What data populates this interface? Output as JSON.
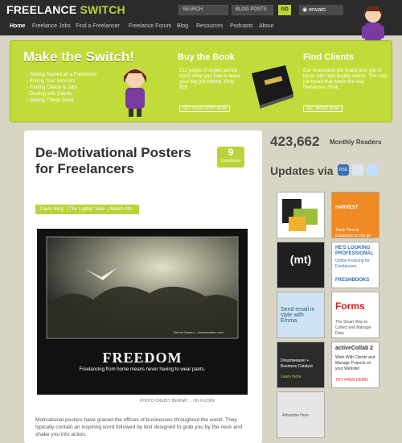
{
  "header": {
    "logo_part1": "FREELANCE",
    "logo_part2": "SWITCH",
    "search_placeholder": "SEARCH",
    "blog_select": "BLOG POSTS",
    "go": "GO",
    "envato": "envato"
  },
  "nav": [
    "Home",
    "Freelance Jobs",
    "Find a Freelancer",
    "Freelance Forum",
    "Blog",
    "Resources",
    "Podcasts",
    "About"
  ],
  "hero": {
    "title": "Make the Switch!",
    "links": [
      "Getting Started as a Freelancer",
      "Pricing Your Services",
      "Finding Clients & Jobs",
      "Dealing with Clients",
      "Getting Things Done"
    ],
    "book_title": "Buy the Book",
    "book_text": "212 pages of expert advice that'll show you how to leave your day job behind. Only $29.",
    "book_btn": "GET YOUR COPY NOW",
    "clients_title": "Find Clients",
    "clients_text": "Our moderated job board puts you in touch with high-quality clients. The only job board that works the way freelancers think.",
    "clients_btn": "GET WORK NOW"
  },
  "article": {
    "title": "De-Motivational Posters for Freelancers",
    "comments_count": "9",
    "comments_label": "Comments",
    "meta": [
      "Travis King",
      "The Lighter Side",
      "March 4th"
    ],
    "poster_title": "FREEDOM",
    "poster_sub": "Freelancing from home means never having to wear pants.",
    "poster_small": "Bernat Casero – bernatcasero.com",
    "credit": "PHOTO CREDIT: BERNAT… ON FLICKR",
    "body": "Motivational posters have graced the offices of businesses throughout the world. They typically contain an inspiring word followed by text designed to grab you by the neck and shake you into action."
  },
  "sidebar": {
    "readers_count": "423,662",
    "readers_label": "Monthly Readers",
    "updates_via": "Updates via",
    "rss": "RSS",
    "ads": [
      "HARVEST",
      "Track Time & Expenses on the go",
      "(mt)",
      "HE'S LOOKING PROFESSIONAL",
      "Online Invoicing for Freelancers",
      "FRESHBOOKS",
      "Send email in style with Emma.",
      "Forms",
      "The Smart Way to Collect and Manage Data",
      "Dreamweaver + Business Catalyst",
      "Learn more",
      "activeCollab 2",
      "Work With Clients and Manage Projects on your Website!",
      "TRY FREE DEMO",
      "Advertise Here"
    ]
  },
  "colors": {
    "accent": "#b8d43a",
    "dark": "#2b2b2b"
  }
}
